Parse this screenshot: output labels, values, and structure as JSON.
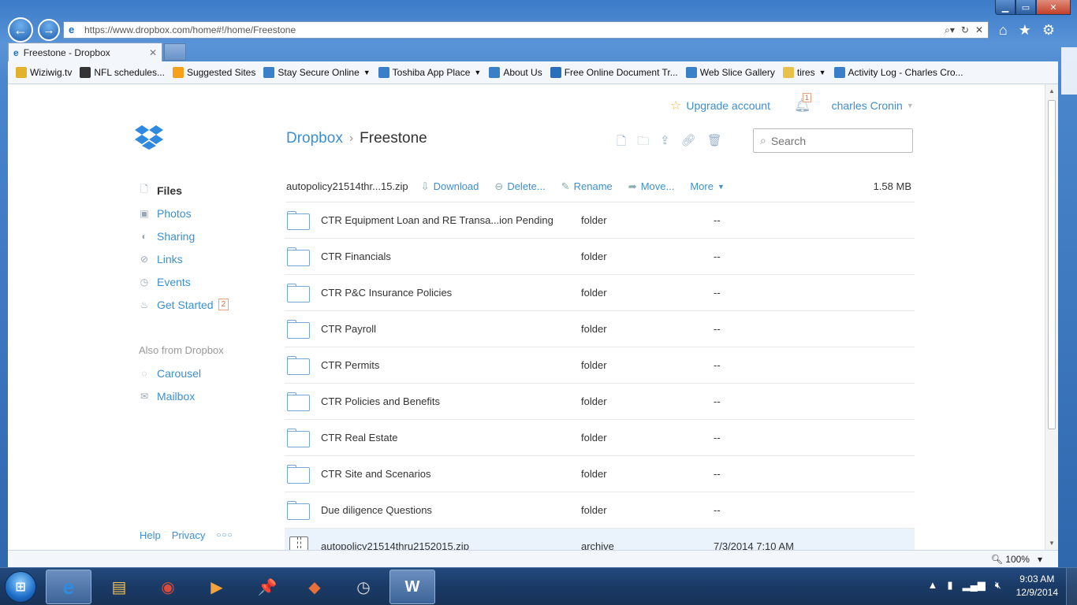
{
  "browser": {
    "address": "https://www.dropbox.com/home#!/home/Freestone",
    "tab_title": "Freestone - Dropbox",
    "favorites": [
      {
        "label": "Wiziwig.tv",
        "icon": "star-add-icon",
        "color": "#e3b22c",
        "dropdown": false
      },
      {
        "label": "NFL schedules...",
        "icon": "nfl-icon",
        "color": "#333333",
        "dropdown": false
      },
      {
        "label": "Suggested Sites",
        "icon": "bing-icon",
        "color": "#f7a11b",
        "dropdown": false
      },
      {
        "label": "Stay Secure Online",
        "icon": "ie-page-icon",
        "color": "#3a80c9",
        "dropdown": true
      },
      {
        "label": "Toshiba App Place",
        "icon": "ie-page-icon",
        "color": "#3a80c9",
        "dropdown": true
      },
      {
        "label": "About Us",
        "icon": "ie-page-icon",
        "color": "#3a80c9",
        "dropdown": false
      },
      {
        "label": "Free Online Document Tr...",
        "icon": "globe-icon",
        "color": "#2b6fb8",
        "dropdown": false
      },
      {
        "label": "Web Slice Gallery",
        "icon": "ie-page-icon",
        "color": "#3a80c9",
        "dropdown": false
      },
      {
        "label": "tires",
        "icon": "folder-icon",
        "color": "#e8c14a",
        "dropdown": true
      },
      {
        "label": "Activity Log - Charles Cro...",
        "icon": "activity-icon",
        "color": "#3a80c9",
        "dropdown": false
      }
    ],
    "zoom": "100%"
  },
  "header": {
    "upgrade": "Upgrade account",
    "notifications": "1",
    "user": "charles Cronin"
  },
  "breadcrumb": {
    "root": "Dropbox",
    "current": "Freestone"
  },
  "search": {
    "placeholder": "Search"
  },
  "sidebar": {
    "items": [
      {
        "label": "Files",
        "icon": "file-icon"
      },
      {
        "label": "Photos",
        "icon": "photo-icon"
      },
      {
        "label": "Sharing",
        "icon": "sharing-icon"
      },
      {
        "label": "Links",
        "icon": "link-icon"
      },
      {
        "label": "Events",
        "icon": "events-icon"
      },
      {
        "label": "Get Started",
        "icon": "cake-icon",
        "badge": "2"
      }
    ],
    "also_heading": "Also from Dropbox",
    "also_items": [
      {
        "label": "Carousel",
        "icon": "carousel-icon"
      },
      {
        "label": "Mailbox",
        "icon": "mailbox-icon"
      }
    ],
    "footer": {
      "help": "Help",
      "privacy": "Privacy",
      "more": "○○○"
    }
  },
  "actionbar": {
    "selected_file": "autopolicy21514thr...15.zip",
    "download": "Download",
    "delete": "Delete...",
    "rename": "Rename",
    "move": "Move...",
    "more": "More",
    "size": "1.58 MB"
  },
  "files": [
    {
      "name": "CTR Equipment Loan and RE Transa...ion Pending",
      "kind": "folder",
      "modified": "--"
    },
    {
      "name": "CTR Financials",
      "kind": "folder",
      "modified": "--"
    },
    {
      "name": "CTR P&C Insurance Policies",
      "kind": "folder",
      "modified": "--"
    },
    {
      "name": "CTR Payroll",
      "kind": "folder",
      "modified": "--"
    },
    {
      "name": "CTR Permits",
      "kind": "folder",
      "modified": "--"
    },
    {
      "name": "CTR Policies and Benefits",
      "kind": "folder",
      "modified": "--"
    },
    {
      "name": "CTR Real Estate",
      "kind": "folder",
      "modified": "--"
    },
    {
      "name": "CTR Site and Scenarios",
      "kind": "folder",
      "modified": "--"
    },
    {
      "name": "Due diligence Questions",
      "kind": "folder",
      "modified": "--"
    },
    {
      "name": "autopolicy21514thru2152015.zip",
      "kind": "archive",
      "modified": "7/3/2014 7:10 AM"
    }
  ],
  "taskbar": {
    "apps": [
      {
        "name": "ie-icon",
        "glyph": "e",
        "color": "#2f8be0"
      },
      {
        "name": "explorer-icon",
        "glyph": "▤",
        "color": "#f2c14e"
      },
      {
        "name": "chrome-icon",
        "glyph": "◉",
        "color": "#d94b3a"
      },
      {
        "name": "media-player-icon",
        "glyph": "▶",
        "color": "#f3a33a"
      },
      {
        "name": "pushpin-icon",
        "glyph": "📌",
        "color": "#d33"
      },
      {
        "name": "app-icon",
        "glyph": "◆",
        "color": "#e7703a"
      },
      {
        "name": "clock-app-icon",
        "glyph": "◷",
        "color": "#ddd"
      },
      {
        "name": "word-icon",
        "glyph": "W",
        "color": "#2b5797"
      }
    ],
    "time": "9:03 AM",
    "date": "12/9/2014"
  }
}
